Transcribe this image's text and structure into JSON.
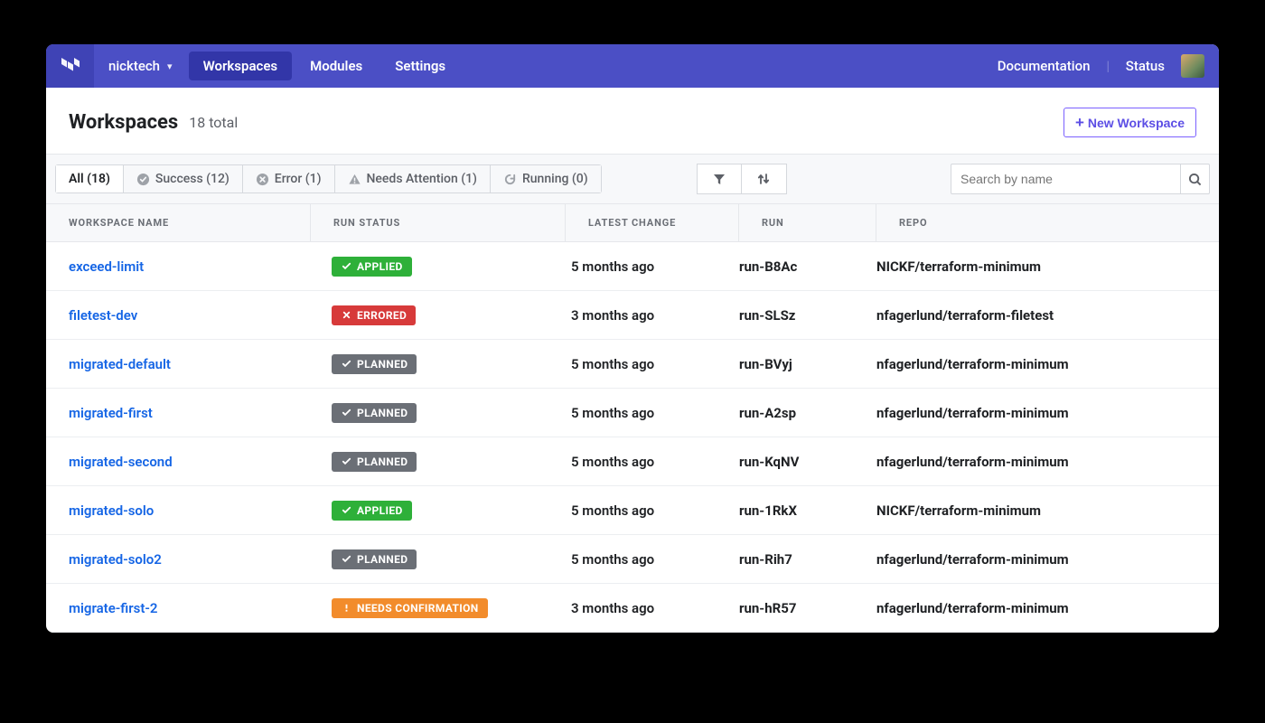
{
  "nav": {
    "org": "nicktech",
    "tabs": [
      {
        "id": "workspaces",
        "label": "Workspaces",
        "active": true
      },
      {
        "id": "modules",
        "label": "Modules",
        "active": false
      },
      {
        "id": "settings",
        "label": "Settings",
        "active": false
      }
    ],
    "right": [
      {
        "id": "documentation",
        "label": "Documentation"
      },
      {
        "id": "status",
        "label": "Status"
      }
    ]
  },
  "header": {
    "title": "Workspaces",
    "count_label": "18 total",
    "new_button": "New Workspace"
  },
  "filters": [
    {
      "id": "all",
      "label": "All (18)",
      "icon": null,
      "active": true
    },
    {
      "id": "success",
      "label": "Success (12)",
      "icon": "check-circle",
      "active": false
    },
    {
      "id": "error",
      "label": "Error (1)",
      "icon": "x-circle",
      "active": false
    },
    {
      "id": "attention",
      "label": "Needs Attention (1)",
      "icon": "alert",
      "active": false
    },
    {
      "id": "running",
      "label": "Running (0)",
      "icon": "refresh",
      "active": false
    }
  ],
  "search": {
    "placeholder": "Search by name"
  },
  "columns": {
    "workspace_name": "WORKSPACE NAME",
    "run_status": "RUN STATUS",
    "latest_change": "LATEST CHANGE",
    "run": "RUN",
    "repo": "REPO"
  },
  "status_labels": {
    "applied": "APPLIED",
    "errored": "ERRORED",
    "planned": "PLANNED",
    "needs": "NEEDS CONFIRMATION"
  },
  "rows": [
    {
      "name": "exceed-limit",
      "status": "applied",
      "latest": "5 months ago",
      "run": "run-B8Ac",
      "repo": "NICKF/terraform-minimum"
    },
    {
      "name": "filetest-dev",
      "status": "errored",
      "latest": "3 months ago",
      "run": "run-SLSz",
      "repo": "nfagerlund/terraform-filetest"
    },
    {
      "name": "migrated-default",
      "status": "planned",
      "latest": "5 months ago",
      "run": "run-BVyj",
      "repo": "nfagerlund/terraform-minimum"
    },
    {
      "name": "migrated-first",
      "status": "planned",
      "latest": "5 months ago",
      "run": "run-A2sp",
      "repo": "nfagerlund/terraform-minimum"
    },
    {
      "name": "migrated-second",
      "status": "planned",
      "latest": "5 months ago",
      "run": "run-KqNV",
      "repo": "nfagerlund/terraform-minimum"
    },
    {
      "name": "migrated-solo",
      "status": "applied",
      "latest": "5 months ago",
      "run": "run-1RkX",
      "repo": "NICKF/terraform-minimum"
    },
    {
      "name": "migrated-solo2",
      "status": "planned",
      "latest": "5 months ago",
      "run": "run-Rih7",
      "repo": "nfagerlund/terraform-minimum"
    },
    {
      "name": "migrate-first-2",
      "status": "needs",
      "latest": "3 months ago",
      "run": "run-hR57",
      "repo": "nfagerlund/terraform-minimum"
    }
  ]
}
